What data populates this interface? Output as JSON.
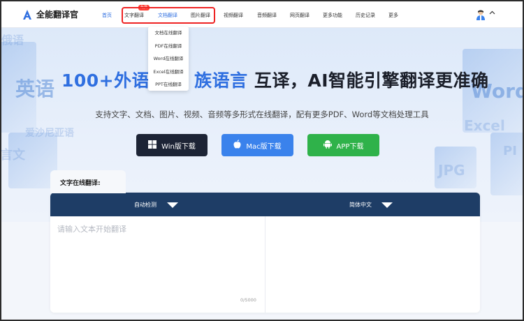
{
  "app": {
    "name": "全能翻译官"
  },
  "nav": {
    "items": [
      {
        "label": "首页"
      },
      {
        "label": "文字翻译"
      },
      {
        "label": "文档翻译"
      },
      {
        "label": "图片翻译"
      },
      {
        "label": "视频翻译"
      },
      {
        "label": "音频翻译"
      },
      {
        "label": "网页翻译"
      },
      {
        "label": "更多功能"
      },
      {
        "label": "历史记录"
      },
      {
        "label": "更多"
      }
    ],
    "free_badge": "免费",
    "active_color": "#2f6fe0"
  },
  "doc_menu": {
    "items": [
      {
        "label": "文档在线翻译"
      },
      {
        "label": "PDF在线翻译"
      },
      {
        "label": "Word在线翻译"
      },
      {
        "label": "Excel在线翻译"
      },
      {
        "label": "PPT在线翻译"
      }
    ]
  },
  "hero": {
    "title_blue": "100+外语",
    "title_blue2": "族语言",
    "title_rest": " 互译，AI智能引擎翻译更准确",
    "subtitle": "支持文字、文档、图片、视频、音频等多形式在线翻译，配有更多PDF、Word等文档处理工具",
    "decor": [
      "英语",
      "Word",
      "Excel",
      "JPG",
      "PDF",
      "俄语",
      "言文",
      "爱沙尼亚语",
      "PI"
    ]
  },
  "downloads": {
    "win": "Win版下载",
    "mac": "Mac版下载",
    "app": "APP下载",
    "colors": {
      "win": "#1d2435",
      "mac": "#3a82ec",
      "app": "#2fb24a"
    }
  },
  "translator": {
    "tab_label": "文字在线翻译:",
    "source_lang": "自动检测",
    "target_lang": "简体中文",
    "placeholder": "请输入文本开始翻译",
    "counter": "0/5000"
  },
  "icons": [
    "logo-icon",
    "avatar-icon",
    "chevron-up-icon",
    "windows-icon",
    "apple-icon",
    "android-icon",
    "caret-down-icon"
  ]
}
